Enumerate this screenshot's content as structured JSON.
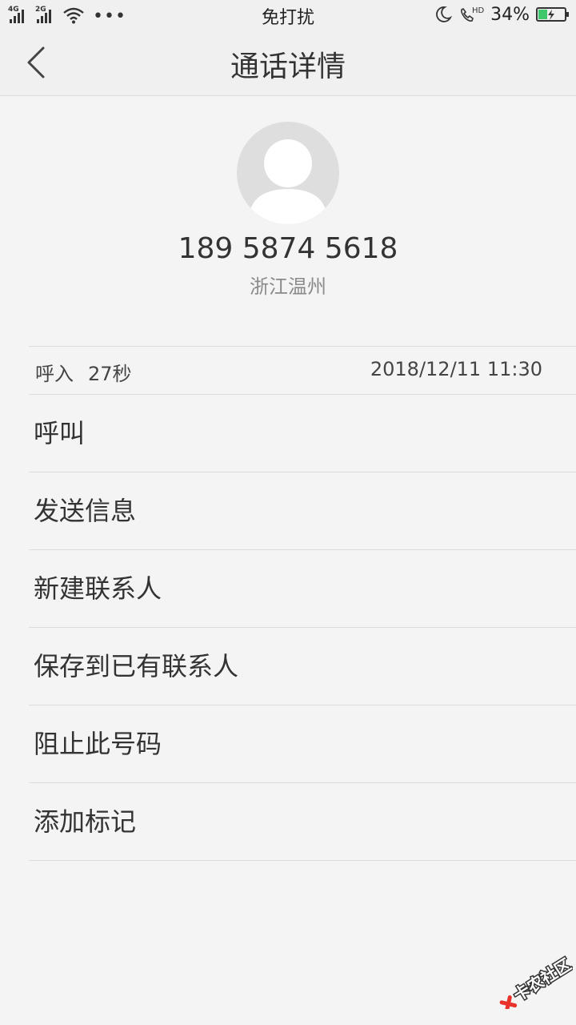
{
  "status_bar": {
    "network_1": "4G",
    "network_2": "2G",
    "mode_text": "免打扰",
    "battery_text": "34%",
    "battery_level": 0.34,
    "icons": [
      "signal-icon",
      "wifi-icon",
      "more-dots-icon",
      "moon-icon",
      "hd-call-icon",
      "battery-icon"
    ]
  },
  "header": {
    "title": "通话详情"
  },
  "contact": {
    "number": "189 5874 5618",
    "location": "浙江温州"
  },
  "call_log": {
    "type": "呼入",
    "duration": "27秒",
    "datetime": "2018/12/11 11:30"
  },
  "menu": {
    "items": [
      {
        "label": "呼叫"
      },
      {
        "label": "发送信息"
      },
      {
        "label": "新建联系人"
      },
      {
        "label": "保存到已有联系人"
      },
      {
        "label": "阻止此号码"
      },
      {
        "label": "添加标记"
      }
    ]
  },
  "watermark": {
    "text": "卡农社区"
  },
  "colors": {
    "background": "#f4f4f4",
    "battery_fill": "#3ec86b",
    "watermark_red": "#e8322b"
  }
}
